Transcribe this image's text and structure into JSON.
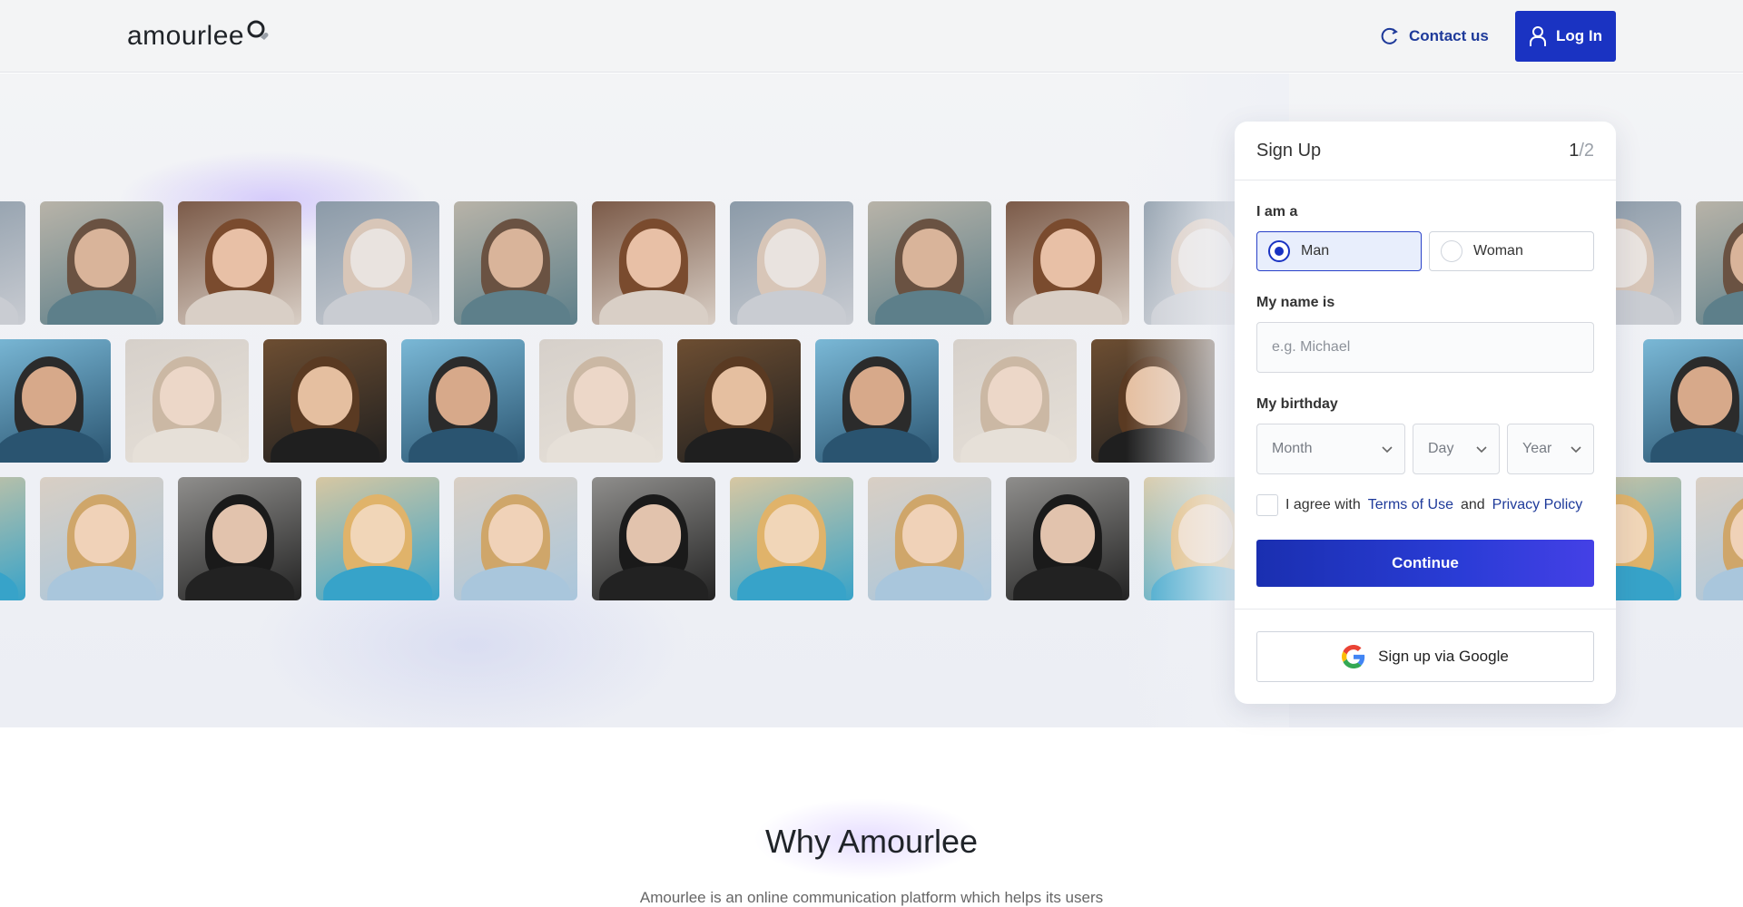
{
  "header": {
    "logo_text": "amourlee",
    "contact_label": "Contact us",
    "login_label": "Log In"
  },
  "signup": {
    "title": "Sign Up",
    "step_current": "1",
    "step_total": "/2",
    "gender_label": "I am a",
    "gender_options": [
      "Man",
      "Woman"
    ],
    "gender_selected": "Man",
    "name_label": "My name is",
    "name_placeholder": "e.g. Michael",
    "birthday_label": "My birthday",
    "month_placeholder": "Month",
    "day_placeholder": "Day",
    "year_placeholder": "Year",
    "agree_prefix": "I agree with",
    "terms_link": "Terms of Use",
    "agree_and": "and",
    "privacy_link": "Privacy Policy",
    "continue_label": "Continue",
    "google_label": "Sign up via Google"
  },
  "why": {
    "title": "Why Amourlee",
    "text": "Amourlee is an online communication platform which helps its users"
  },
  "colors": {
    "brand": "#1a33c2",
    "link": "#1e3a9a"
  }
}
